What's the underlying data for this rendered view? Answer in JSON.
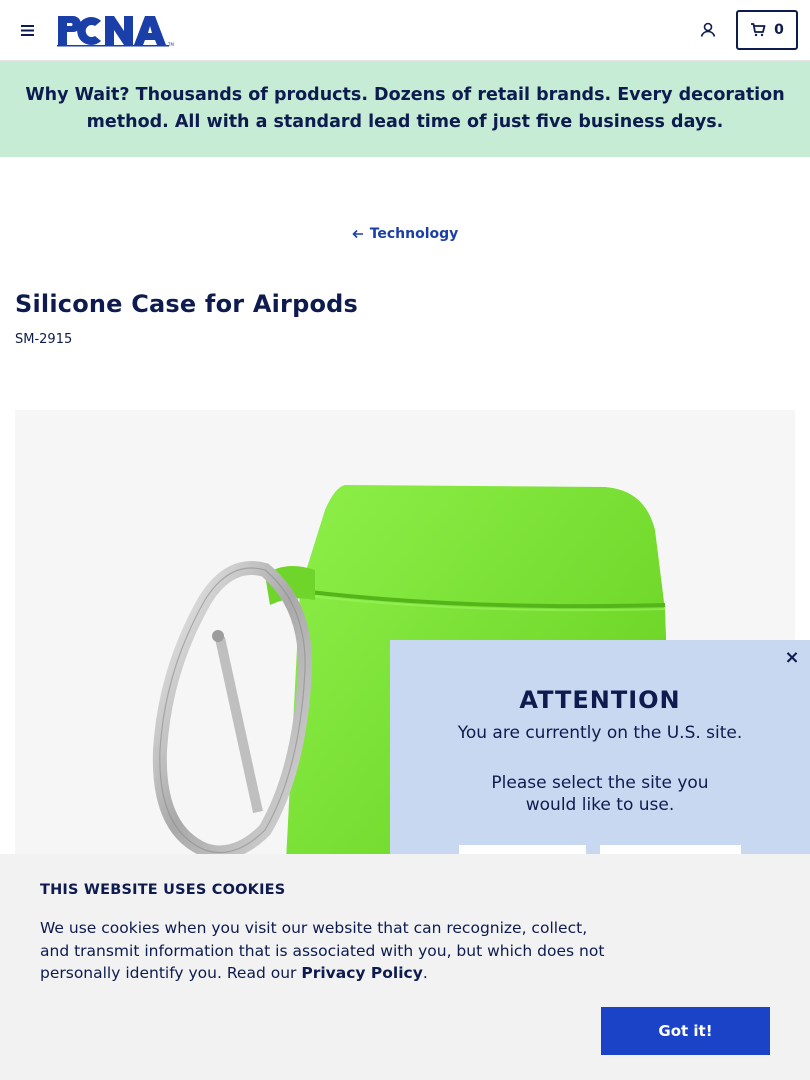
{
  "header": {
    "logo_text": "PCNA",
    "cart_count": "0",
    "icons": {
      "menu": "hamburger-menu-icon",
      "account": "user-account-icon",
      "cart": "shopping-cart-icon"
    }
  },
  "promo": {
    "lead": "Why Wait?",
    "text": " Thousands of products. Dozens of retail brands. Every decoration method. All with a standard lead time of just five business days."
  },
  "breadcrumb": {
    "label": "Technology"
  },
  "product": {
    "title": "Silicone Case for Airpods",
    "sku": "SM-2915",
    "case_color": "#7ee03a"
  },
  "attention_modal": {
    "close_label": "×",
    "heading": "ATTENTION",
    "line1": "You are currently on the U.S. site.",
    "line2": "Please select the site you would like to use."
  },
  "cookie_banner": {
    "heading": "THIS WEBSITE USES COOKIES",
    "text": "We use cookies when you visit our website that can recognize, collect, and transmit information that is associated with you, but which does not personally identify you. Read our ",
    "link_label": "Privacy Policy",
    "text_end": ".",
    "button_label": "Got it!"
  },
  "colors": {
    "brand_navy": "#0d1b4f",
    "promo_bg": "#c6ecd6",
    "modal_bg": "#c8d8f0",
    "button_blue": "#1b43c7"
  }
}
